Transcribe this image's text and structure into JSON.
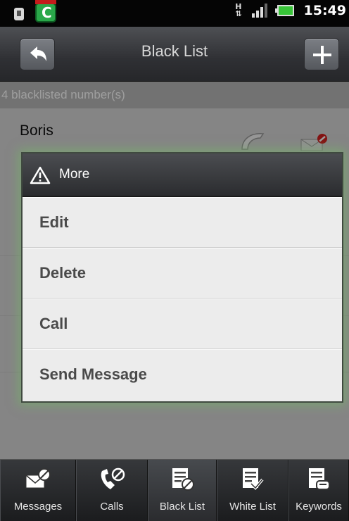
{
  "status_bar": {
    "time": "15:49",
    "network": "H",
    "icons": [
      "debug-icon",
      "app-notification-icon",
      "network-h-icon",
      "signal-icon",
      "battery-icon"
    ]
  },
  "title_bar": {
    "title": "Black List",
    "back_icon": "back-arrow-icon",
    "add_icon": "plus-icon"
  },
  "list": {
    "header": "4 blacklisted number(s)",
    "contacts": [
      {
        "name": "Boris"
      }
    ]
  },
  "dialog": {
    "title": "More",
    "icon": "warning-icon",
    "items": [
      "Edit",
      "Delete",
      "Call",
      "Send Message"
    ]
  },
  "tabs": [
    {
      "label": "Messages",
      "icon": "messages-blocked-icon",
      "active": false
    },
    {
      "label": "Calls",
      "icon": "calls-blocked-icon",
      "active": false
    },
    {
      "label": "Black List",
      "icon": "black-list-icon",
      "active": true
    },
    {
      "label": "White List",
      "icon": "white-list-icon",
      "active": false
    },
    {
      "label": "Keywords",
      "icon": "keywords-icon",
      "active": false
    }
  ],
  "colors": {
    "bar_dark": "#2f3034",
    "list_bg": "#d7d7d7",
    "header_bg": "#b9b9b9",
    "dialog_glow": "#78aa6e",
    "battery_green": "#38c538"
  }
}
